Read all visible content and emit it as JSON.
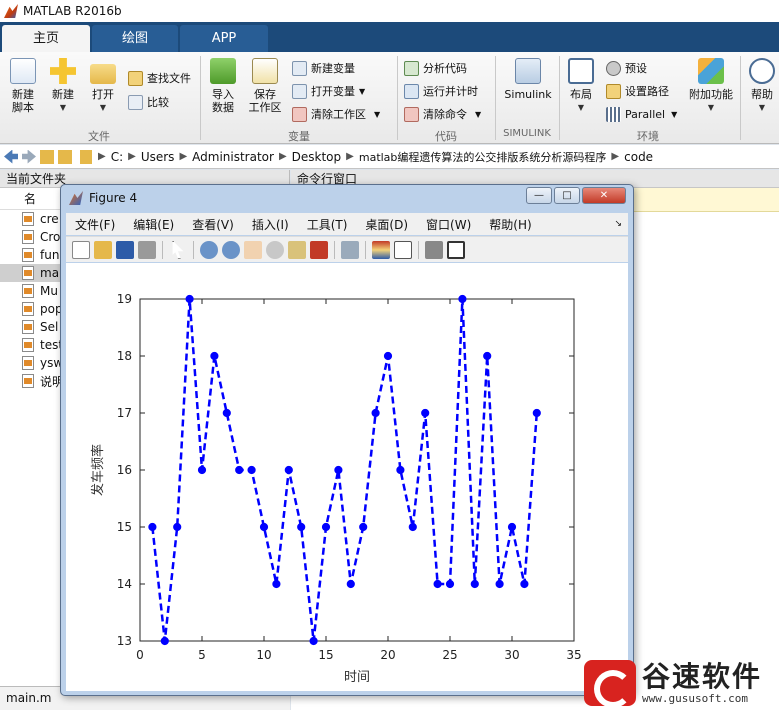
{
  "app": {
    "title": "MATLAB R2016b"
  },
  "tabs": [
    {
      "label": "主页",
      "active": true
    },
    {
      "label": "绘图",
      "active": false
    },
    {
      "label": "APP",
      "active": false
    }
  ],
  "ribbon": {
    "file": {
      "new_script": "新建\n脚本",
      "new": "新建",
      "open": "打开",
      "find_files": "查找文件",
      "compare": "比较",
      "group": "文件"
    },
    "variable": {
      "import_data": "导入\n数据",
      "save_workspace": "保存\n工作区",
      "new_variable": "新建变量",
      "open_variable": "打开变量",
      "clear_workspace": "清除工作区",
      "group": "变量"
    },
    "code": {
      "analyze": "分析代码",
      "run_and_time": "运行并计时",
      "clear_commands": "清除命令",
      "group": "代码"
    },
    "simulink": {
      "label": "Simulink",
      "group": "SIMULINK"
    },
    "environment": {
      "layout": "布局",
      "preferences": "预设",
      "set_path": "设置路径",
      "parallel": "Parallel",
      "addons": "附加功能",
      "group": "环境"
    },
    "help": {
      "label": "帮助"
    }
  },
  "address": {
    "crumbs": [
      "C:",
      "Users",
      "Administrator",
      "Desktop",
      "matlab编程遗传算法的公交排版系统分析源码程序",
      "code"
    ]
  },
  "left_panel": {
    "title": "当前文件夹",
    "column": "名",
    "files": [
      {
        "name": "cre",
        "selected": false
      },
      {
        "name": "Cro",
        "selected": false
      },
      {
        "name": "fun",
        "selected": false
      },
      {
        "name": "ma",
        "selected": true
      },
      {
        "name": "Mu",
        "selected": false
      },
      {
        "name": "pop",
        "selected": false
      },
      {
        "name": "Sel",
        "selected": false
      },
      {
        "name": "test",
        "selected": false
      },
      {
        "name": "ysw",
        "selected": false
      },
      {
        "name": "说明",
        "selected": false
      }
    ],
    "status": "main.m"
  },
  "right_panel": {
    "title": "命令行窗口"
  },
  "figure": {
    "title": "Figure 4",
    "menu": [
      "文件(F)",
      "编辑(E)",
      "查看(V)",
      "插入(I)",
      "工具(T)",
      "桌面(D)",
      "窗口(W)",
      "帮助(H)"
    ],
    "minimize": "—",
    "maximize": "□",
    "close": "✕"
  },
  "chart_data": {
    "type": "line",
    "x": [
      1,
      2,
      3,
      4,
      5,
      6,
      7,
      8,
      9,
      10,
      11,
      12,
      13,
      14,
      15,
      16,
      17,
      18,
      19,
      20,
      21,
      22,
      23,
      24,
      25,
      26,
      27,
      28,
      29,
      30,
      31,
      32
    ],
    "series": [
      {
        "values": [
          15,
          13,
          15,
          19,
          16,
          18,
          17,
          16,
          16,
          15,
          14,
          16,
          15,
          13,
          15,
          16,
          14,
          15,
          17,
          18,
          16,
          15,
          17,
          14,
          14,
          19,
          14,
          18,
          14,
          15,
          14,
          17
        ]
      }
    ],
    "xlabel": "时间",
    "ylabel": "发车频率",
    "xlim": [
      0,
      35
    ],
    "ylim": [
      13,
      19
    ],
    "xticks": [
      0,
      5,
      10,
      15,
      20,
      25,
      30,
      35
    ],
    "yticks": [
      13,
      14,
      15,
      16,
      17,
      18,
      19
    ],
    "line_style": "dashed",
    "marker": "circle",
    "color": "#0000ff",
    "grid": false
  },
  "watermark": {
    "name": "谷速软件",
    "url": "www.gususoft.com"
  },
  "colors": {
    "accent": "#1c4a7a",
    "plot_line": "#0000ff"
  }
}
